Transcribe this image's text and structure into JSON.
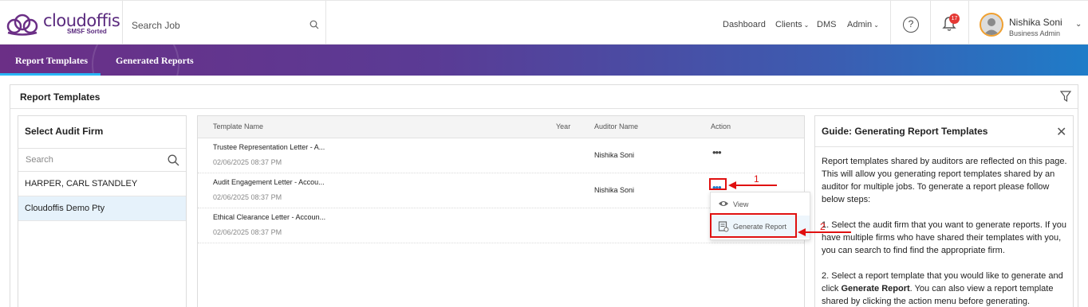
{
  "header": {
    "brand": "cloudoffis",
    "tagline": "SMSF Sorted",
    "search_placeholder": "Search Job",
    "nav": {
      "dashboard": "Dashboard",
      "clients": "Clients",
      "dms": "DMS",
      "admin": "Admin"
    },
    "help_symbol": "?",
    "notification_count": "17",
    "user": {
      "name": "Nishika Soni",
      "role": "Business Admin"
    }
  },
  "tabs": {
    "report_templates": "Report Templates",
    "generated_reports": "Generated Reports"
  },
  "card": {
    "title": "Report Templates"
  },
  "firms": {
    "title": "Select Audit Firm",
    "search_placeholder": "Search",
    "items": [
      {
        "name": "HARPER, CARL STANDLEY"
      },
      {
        "name": "Cloudoffis Demo Pty"
      }
    ]
  },
  "templates": {
    "columns": {
      "name": "Template Name",
      "year": "Year",
      "auditor": "Auditor Name",
      "action": "Action"
    },
    "rows": [
      {
        "name": "Trustee Representation Letter - A...",
        "date": "02/06/2025 08:37 PM",
        "year": "",
        "auditor": "Nishika Soni"
      },
      {
        "name": "Audit Engagement Letter - Accou...",
        "date": "02/06/2025 08:37 PM",
        "year": "",
        "auditor": "Nishika Soni"
      },
      {
        "name": "Ethical Clearance Letter - Accoun...",
        "date": "02/06/2025 08:37 PM",
        "year": "",
        "auditor": ""
      }
    ]
  },
  "action_menu": {
    "view": "View",
    "generate_report": "Generate Report"
  },
  "guide": {
    "title": "Guide: Generating Report Templates",
    "p1": "Report templates shared by auditors are reflected on this page. This will allow you generating report templates shared by an auditor for multiple jobs. To generate a report please follow below steps:",
    "p2": "1. Select the audit firm that you want to generate reports. If you have multiple firms who have shared their templates with you, you can search to find find the appropriate firm.",
    "p3_prefix": "2. Select a report template that you would like to generate and click ",
    "p3_bold": "Generate Report",
    "p3_suffix": ". You can also view a report template shared by clicking the action menu before generating."
  },
  "annotations": {
    "step1": "1",
    "step2": "2",
    "color": "#e01010"
  },
  "colors": {
    "brand_purple": "#5a2a7e",
    "tab_gradient_start": "#6b2f86",
    "tab_gradient_end": "#1f7cc8",
    "tab_active_underline": "#29b6f6",
    "badge_red": "#e53935"
  }
}
